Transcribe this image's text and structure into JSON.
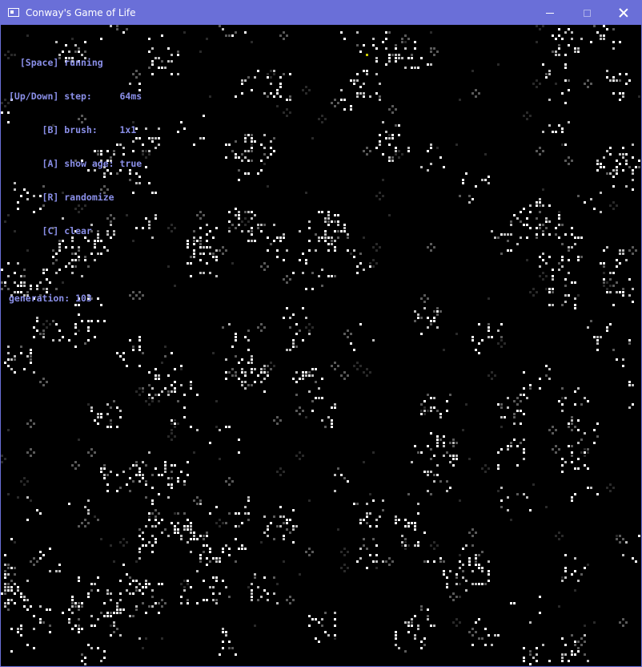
{
  "window": {
    "title": "Conway's Game of Life",
    "titlebar_color": "#6a6fd8"
  },
  "controls": {
    "minimize_icon": "minimize-icon",
    "maximize_icon": "maximize-icon",
    "close_icon": "close-icon"
  },
  "hud": {
    "color": "#8a8fe8",
    "lines": {
      "space": "  [Space] running",
      "updown": "[Up/Down] step:     64ms",
      "brush": "      [B] brush:    1x1",
      "age": "      [A] show age: true",
      "randomize": "      [R] randomize",
      "clear": "      [C] clear",
      "blank": "",
      "generation": "generation: 103"
    }
  },
  "grid": {
    "cell_colors": {
      "alive": "#ffffff",
      "aging": "#bdbdbd",
      "old": "#5a5a5a",
      "faint": "#2a2a2a",
      "accent": "#c8c800"
    }
  }
}
